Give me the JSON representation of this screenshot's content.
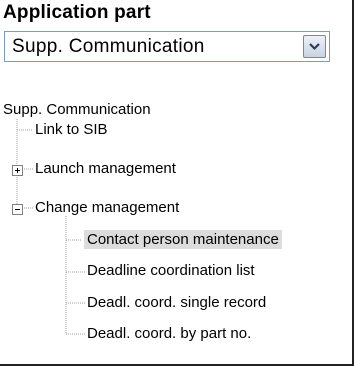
{
  "panel": {
    "title": "Application part"
  },
  "application_select": {
    "selected_value": "Supp. Communication"
  },
  "tree": {
    "root_label": "Supp. Communication",
    "items": [
      {
        "label": "Link to SIB",
        "expanded": null
      },
      {
        "label": "Launch management",
        "expanded": false
      },
      {
        "label": "Change management",
        "expanded": true,
        "children": [
          {
            "label": "Contact person maintenance",
            "selected": true
          },
          {
            "label": "Deadline coordination list"
          },
          {
            "label": "Deadl. coord. single record"
          },
          {
            "label": "Deadl. coord. by part no."
          }
        ]
      }
    ]
  },
  "colors": {
    "selection_background": "#dcdcdc",
    "tree_line": "#a0a0a0",
    "select_border": "#7f9db9"
  }
}
